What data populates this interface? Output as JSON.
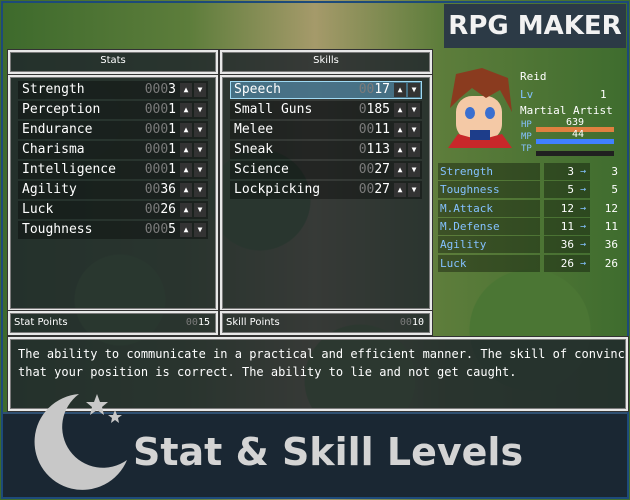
{
  "logo_text": "RPG MAKER",
  "banner_title": "Stat & Skill Levels",
  "stats_window": {
    "title": "Stats",
    "rows": [
      {
        "label": "Strength",
        "prefix": "000",
        "value": "3"
      },
      {
        "label": "Perception",
        "prefix": "000",
        "value": "1"
      },
      {
        "label": "Endurance",
        "prefix": "000",
        "value": "1"
      },
      {
        "label": "Charisma",
        "prefix": "000",
        "value": "1"
      },
      {
        "label": "Intelligence",
        "prefix": "000",
        "value": "1"
      },
      {
        "label": "Agility",
        "prefix": "00",
        "value": "36"
      },
      {
        "label": "Luck",
        "prefix": "00",
        "value": "26"
      },
      {
        "label": "Toughness",
        "prefix": "000",
        "value": "5"
      }
    ],
    "points_label": "Stat Points",
    "points_prefix": "00",
    "points_value": "15"
  },
  "skills_window": {
    "title": "Skills",
    "rows": [
      {
        "label": "Speech",
        "prefix": "00",
        "value": "17"
      },
      {
        "label": "Small Guns",
        "prefix": "0",
        "value": "185"
      },
      {
        "label": "Melee",
        "prefix": "00",
        "value": "11"
      },
      {
        "label": "Sneak",
        "prefix": "0",
        "value": "113"
      },
      {
        "label": "Science",
        "prefix": "00",
        "value": "27"
      },
      {
        "label": "Lockpicking",
        "prefix": "00",
        "value": "27"
      }
    ],
    "points_label": "Skill Points",
    "points_prefix": "00",
    "points_value": "10"
  },
  "actor": {
    "name": "Reid",
    "level_label": "Lv",
    "level": "1",
    "class": "Martial Artist",
    "hp_label": "HP",
    "hp": "639",
    "hp_ratio": 1.0,
    "mp_label": "MP",
    "mp": "44",
    "mp_ratio": 1.0,
    "tp_label": "TP",
    "tp_ratio": 0.0,
    "hp_color": "#e08040",
    "mp_color": "#4080ff",
    "params": [
      {
        "name": "Strength",
        "current": "3",
        "next": "3"
      },
      {
        "name": "Toughness",
        "current": "5",
        "next": "5"
      },
      {
        "name": "M.Attack",
        "current": "12",
        "next": "12"
      },
      {
        "name": "M.Defense",
        "current": "11",
        "next": "11"
      },
      {
        "name": "Agility",
        "current": "36",
        "next": "36"
      },
      {
        "name": "Luck",
        "current": "26",
        "next": "26"
      }
    ],
    "arrow_glyph": "→"
  },
  "description": {
    "line1": "The ability to communicate in a practical and efficient manner. The skill of convincing othe",
    "line2": "that your position is correct. The ability to lie and not get caught."
  },
  "arrow_up": "▲",
  "arrow_down": "▼"
}
